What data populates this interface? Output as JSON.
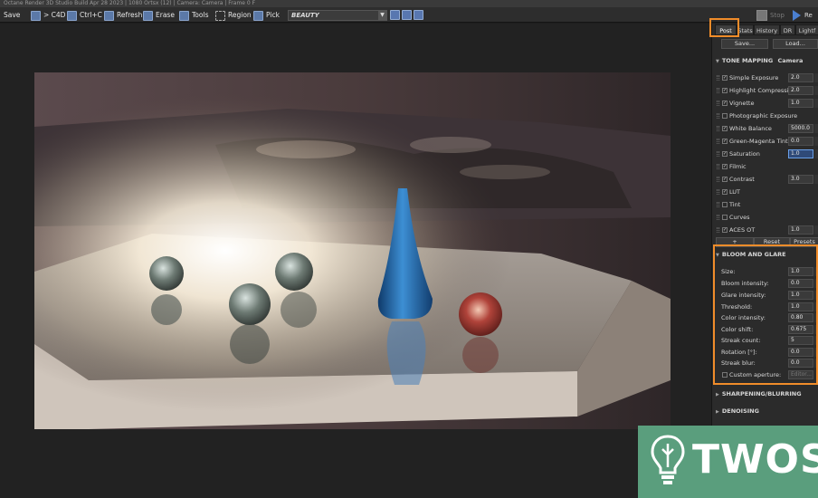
{
  "window": {
    "title": "Octane Render 3D Studio Build Apr 28 2023 | 1080 Ortsx (12) | Camera: Camera | Frame 0 F"
  },
  "toolbar": {
    "save": "Save",
    "c4d": "> C4D",
    "ctrlc": "Ctrl+C",
    "refresh": "Refresh",
    "erase": "Erase",
    "tools": "Tools",
    "region": "Region",
    "pick": "Pick",
    "render_pass": "BEAUTY",
    "stop": "Stop",
    "render": "Re"
  },
  "tabs": [
    "Post",
    "Stats",
    "History",
    "DR",
    "Lightf"
  ],
  "buttons": {
    "save": "Save...",
    "load": "Load...",
    "add": "+",
    "reset": "Reset",
    "presets": "Presets"
  },
  "tone_mapping": {
    "title": "TONE MAPPING",
    "subtitle": "Camera",
    "rows": [
      {
        "label": "Simple Exposure",
        "checked": true,
        "value": "2.0"
      },
      {
        "label": "Highlight Compression",
        "checked": true,
        "value": "2.0"
      },
      {
        "label": "Vignette",
        "checked": true,
        "value": "1.0"
      },
      {
        "label": "Photographic Exposure",
        "checked": false,
        "value": ""
      },
      {
        "label": "White Balance",
        "checked": true,
        "value": "5000.0"
      },
      {
        "label": "Green-Magenta Tint",
        "checked": true,
        "value": "0.0"
      },
      {
        "label": "Saturation",
        "checked": true,
        "value": "1.0"
      },
      {
        "label": "Filmic",
        "checked": true,
        "value": ""
      },
      {
        "label": "Contrast",
        "checked": true,
        "value": "3.0"
      },
      {
        "label": "LUT",
        "checked": true,
        "value": ""
      },
      {
        "label": "Tint",
        "checked": false,
        "value": ""
      },
      {
        "label": "Curves",
        "checked": false,
        "value": ""
      },
      {
        "label": "ACES OT",
        "checked": true,
        "value": "1.0"
      }
    ]
  },
  "bloom_glare": {
    "title": "BLOOM AND GLARE",
    "rows": [
      {
        "label": "Size:",
        "value": "1.0"
      },
      {
        "label": "Bloom intensity:",
        "value": "0.0"
      },
      {
        "label": "Glare intensity:",
        "value": "1.0"
      },
      {
        "label": "Threshold:",
        "value": "1.0"
      },
      {
        "label": "Color intensity:",
        "value": "0.80"
      },
      {
        "label": "Color shift:",
        "value": "0.675"
      },
      {
        "label": "Streak count:",
        "value": "5"
      },
      {
        "label": "Rotation [°]:",
        "value": "0.0"
      },
      {
        "label": "Streak blur:",
        "value": "0.0"
      }
    ],
    "custom_aperture": "Custom aperture:",
    "editor": "Editor..."
  },
  "sections": {
    "sharpening": "SHARPENING/BLURRING",
    "denoising": "DENOISING"
  },
  "logo": {
    "word": "TWOS"
  },
  "colors": {
    "highlight": "#f08c2a",
    "brand": "#5a9e7d",
    "accent": "#4a7fd0"
  }
}
